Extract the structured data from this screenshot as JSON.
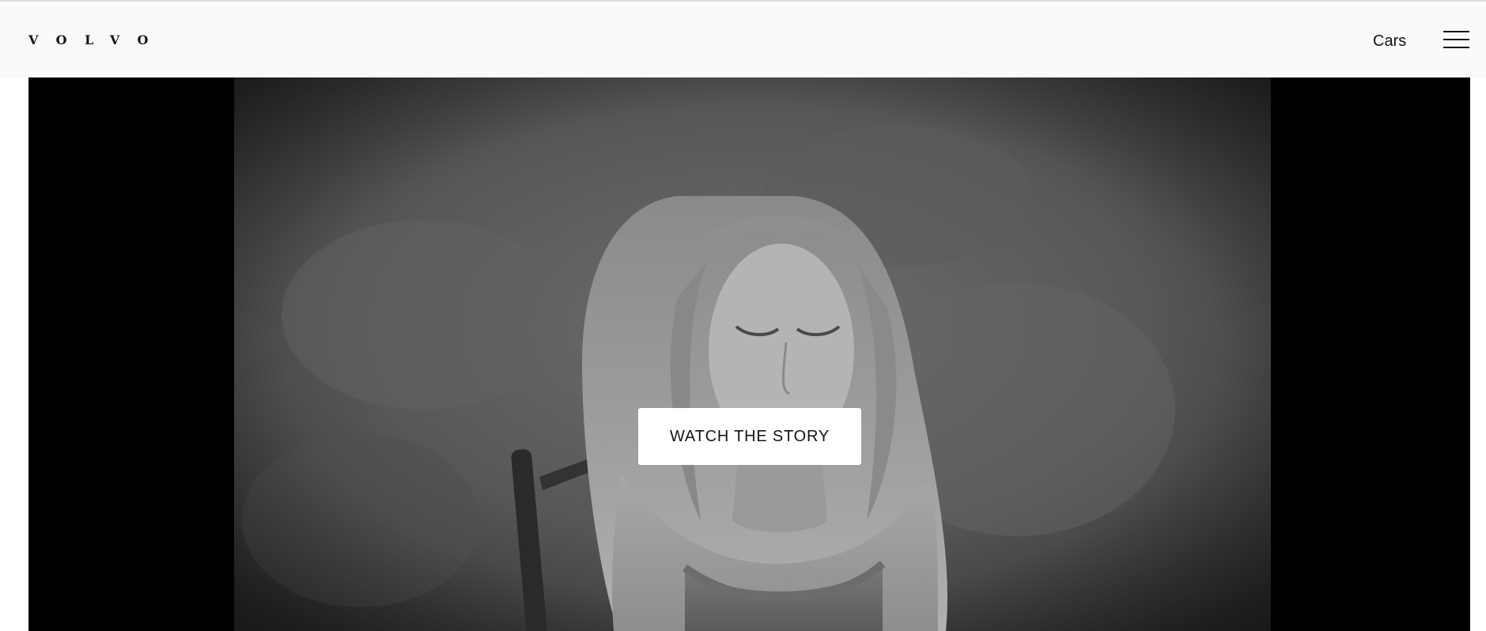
{
  "header": {
    "logo_text": "VOLVO",
    "nav": {
      "cars_label": "Cars"
    },
    "menu_icon": "hamburger-menu-icon"
  },
  "hero": {
    "cta_label": "WATCH THE STORY",
    "media": "black-and-white video still of a young girl with long hair seated on a wooden chair",
    "colors": {
      "letterbox": "#000000",
      "cta_background": "#ffffff",
      "cta_text": "#141414"
    }
  },
  "colors": {
    "header_background": "#fafafa",
    "text": "#141414"
  }
}
